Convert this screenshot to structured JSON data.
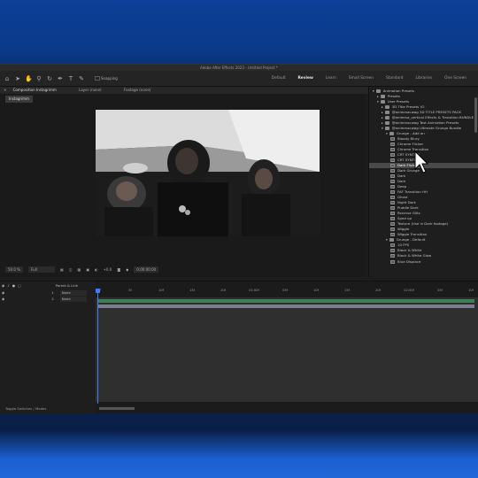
{
  "window": {
    "title": "Adobe After Effects 2023 - Untitled Project *"
  },
  "toolbar": {
    "snapping_label": "Snapping",
    "workspaces": [
      "Default",
      "Review",
      "Learn",
      "Small Screen",
      "Standard",
      "Libraries",
      "One Screen"
    ],
    "active_workspace": "Review"
  },
  "composition_panel": {
    "tab_label": "Composition Instagrimm",
    "layer_tab": "Layer (none)",
    "footage_tab": "Footage (none)",
    "comp_name_chip": "Instagrimm",
    "zoom": "50.0 %",
    "resolution": "Full",
    "exposure": "+0.0",
    "timecode": "0:00:00:00"
  },
  "effects_panel": {
    "items": [
      {
        "label": "Animation Presets",
        "level": 0,
        "kind": "folder",
        "expanded": true
      },
      {
        "label": "Presets",
        "level": 1,
        "kind": "folder",
        "expanded": false
      },
      {
        "label": "User Presets",
        "level": 1,
        "kind": "folder",
        "expanded": true
      },
      {
        "label": "3D Title Presets V2",
        "level": 2,
        "kind": "folder",
        "expanded": false
      },
      {
        "label": "@animmacwag 3D TITLE PRESETS PACK",
        "level": 2,
        "kind": "folder",
        "expanded": false
      },
      {
        "label": "@animma_vertical Effects & Transition BUNDLE",
        "level": 2,
        "kind": "folder",
        "expanded": false
      },
      {
        "label": "@animmacwag Text Animation Presets",
        "level": 2,
        "kind": "folder",
        "expanded": false
      },
      {
        "label": "@animmacwag Ultimate Grunge Bundle",
        "level": 2,
        "kind": "folder",
        "expanded": true
      },
      {
        "label": "Grunge - Add on",
        "level": 3,
        "kind": "folder",
        "expanded": true
      },
      {
        "label": "Bloody Blury",
        "level": 4,
        "kind": "preset"
      },
      {
        "label": "Chrome Flicker",
        "level": 4,
        "kind": "preset"
      },
      {
        "label": "Chrome Transition",
        "level": 4,
        "kind": "preset"
      },
      {
        "label": "CRT SYNTH 1",
        "level": 4,
        "kind": "preset"
      },
      {
        "label": "CRT SYNTH 2",
        "level": 4,
        "kind": "preset"
      },
      {
        "label": "Dark Flicker",
        "level": 4,
        "kind": "preset",
        "selected": true
      },
      {
        "label": "Dark Grunge",
        "level": 4,
        "kind": "preset"
      },
      {
        "label": "Dark",
        "level": 4,
        "kind": "preset"
      },
      {
        "label": "Dark",
        "level": 4,
        "kind": "preset"
      },
      {
        "label": "Deep",
        "level": 4,
        "kind": "preset"
      },
      {
        "label": "FAF Transition HH",
        "level": 4,
        "kind": "preset"
      },
      {
        "label": "Ghost",
        "level": 4,
        "kind": "preset"
      },
      {
        "label": "Night Dark",
        "level": 4,
        "kind": "preset"
      },
      {
        "label": "Puddle Dark",
        "level": 4,
        "kind": "preset"
      },
      {
        "label": "Reverse Glitz",
        "level": 4,
        "kind": "preset"
      },
      {
        "label": "Sped up",
        "level": 4,
        "kind": "preset"
      },
      {
        "label": "Texture (Use in Dark footage)",
        "level": 4,
        "kind": "preset"
      },
      {
        "label": "Wiggle",
        "level": 4,
        "kind": "preset"
      },
      {
        "label": "Wiggle Transition",
        "level": 4,
        "kind": "preset"
      },
      {
        "label": "Grunge - Default",
        "level": 3,
        "kind": "folder",
        "expanded": true
      },
      {
        "label": "10 FPS",
        "level": 4,
        "kind": "preset"
      },
      {
        "label": "Black & White",
        "level": 4,
        "kind": "preset"
      },
      {
        "label": "Black & White Glow",
        "level": 4,
        "kind": "preset"
      },
      {
        "label": "Blue Displace",
        "level": 4,
        "kind": "preset"
      }
    ]
  },
  "timeline": {
    "ruler_ticks": [
      "0f",
      "5f",
      "10f",
      "15f",
      "20f",
      "01:00f",
      "05f",
      "10f",
      "15f",
      "20f",
      "02:00f",
      "05f",
      "10f"
    ],
    "header_label": "Parent & Link",
    "layers": [
      {
        "num": "1",
        "parent": "None"
      },
      {
        "num": "2",
        "parent": "None"
      }
    ],
    "status_left": "Toggle Switches / Modes"
  },
  "colors": {
    "accent": "#3a7bff",
    "layer1": "#3f7f55",
    "layer2": "#7a7f90"
  }
}
